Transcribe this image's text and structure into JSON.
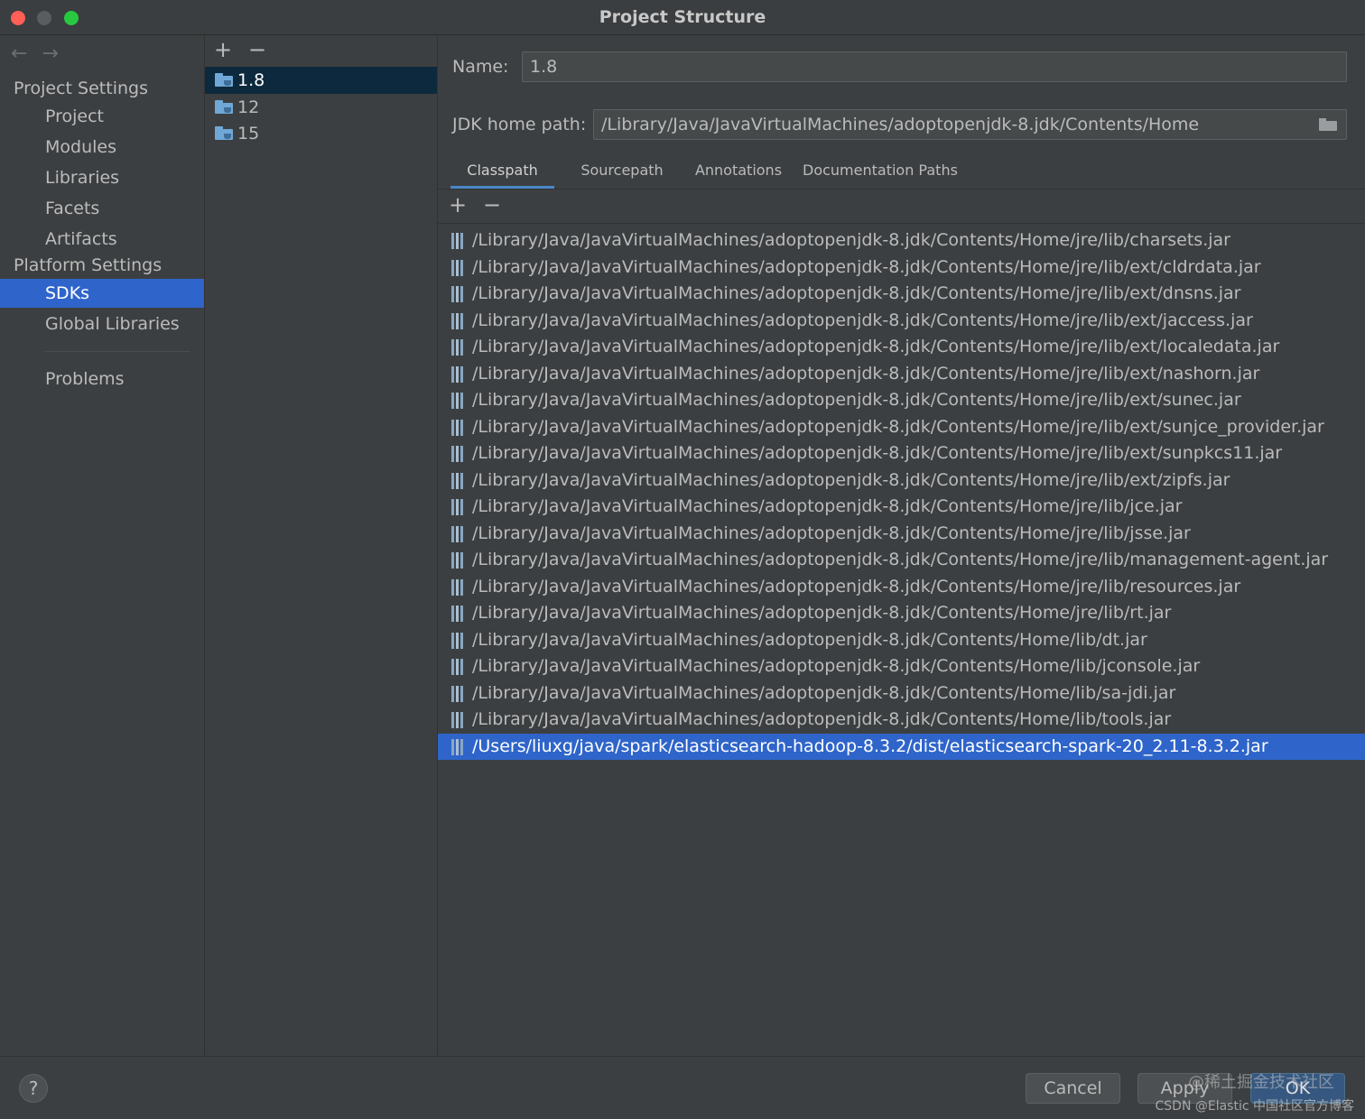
{
  "window": {
    "title": "Project Structure"
  },
  "sidebar": {
    "back_glyph": "←",
    "forward_glyph": "→",
    "project_settings_label": "Project Settings",
    "project_items": [
      "Project",
      "Modules",
      "Libraries",
      "Facets",
      "Artifacts"
    ],
    "platform_settings_label": "Platform Settings",
    "platform_items": [
      "SDKs",
      "Global Libraries"
    ],
    "selected_item": "SDKs",
    "problems_label": "Problems"
  },
  "sdk_list": {
    "add_glyph": "+",
    "remove_glyph": "−",
    "items": [
      "1.8",
      "12",
      "15"
    ],
    "selected": "1.8"
  },
  "detail": {
    "name_label": "Name:",
    "name_value": "1.8",
    "jdk_home_label": "JDK home path:",
    "jdk_home_value": "/Library/Java/JavaVirtualMachines/adoptopenjdk-8.jdk/Contents/Home",
    "tabs": [
      "Classpath",
      "Sourcepath",
      "Annotations",
      "Documentation Paths"
    ],
    "active_tab": "Classpath",
    "add_glyph": "+",
    "remove_glyph": "−",
    "classpath": [
      "/Library/Java/JavaVirtualMachines/adoptopenjdk-8.jdk/Contents/Home/jre/lib/charsets.jar",
      "/Library/Java/JavaVirtualMachines/adoptopenjdk-8.jdk/Contents/Home/jre/lib/ext/cldrdata.jar",
      "/Library/Java/JavaVirtualMachines/adoptopenjdk-8.jdk/Contents/Home/jre/lib/ext/dnsns.jar",
      "/Library/Java/JavaVirtualMachines/adoptopenjdk-8.jdk/Contents/Home/jre/lib/ext/jaccess.jar",
      "/Library/Java/JavaVirtualMachines/adoptopenjdk-8.jdk/Contents/Home/jre/lib/ext/localedata.jar",
      "/Library/Java/JavaVirtualMachines/adoptopenjdk-8.jdk/Contents/Home/jre/lib/ext/nashorn.jar",
      "/Library/Java/JavaVirtualMachines/adoptopenjdk-8.jdk/Contents/Home/jre/lib/ext/sunec.jar",
      "/Library/Java/JavaVirtualMachines/adoptopenjdk-8.jdk/Contents/Home/jre/lib/ext/sunjce_provider.jar",
      "/Library/Java/JavaVirtualMachines/adoptopenjdk-8.jdk/Contents/Home/jre/lib/ext/sunpkcs11.jar",
      "/Library/Java/JavaVirtualMachines/adoptopenjdk-8.jdk/Contents/Home/jre/lib/ext/zipfs.jar",
      "/Library/Java/JavaVirtualMachines/adoptopenjdk-8.jdk/Contents/Home/jre/lib/jce.jar",
      "/Library/Java/JavaVirtualMachines/adoptopenjdk-8.jdk/Contents/Home/jre/lib/jsse.jar",
      "/Library/Java/JavaVirtualMachines/adoptopenjdk-8.jdk/Contents/Home/jre/lib/management-agent.jar",
      "/Library/Java/JavaVirtualMachines/adoptopenjdk-8.jdk/Contents/Home/jre/lib/resources.jar",
      "/Library/Java/JavaVirtualMachines/adoptopenjdk-8.jdk/Contents/Home/jre/lib/rt.jar",
      "/Library/Java/JavaVirtualMachines/adoptopenjdk-8.jdk/Contents/Home/lib/dt.jar",
      "/Library/Java/JavaVirtualMachines/adoptopenjdk-8.jdk/Contents/Home/lib/jconsole.jar",
      "/Library/Java/JavaVirtualMachines/adoptopenjdk-8.jdk/Contents/Home/lib/sa-jdi.jar",
      "/Library/Java/JavaVirtualMachines/adoptopenjdk-8.jdk/Contents/Home/lib/tools.jar",
      "/Users/liuxg/java/spark/elasticsearch-hadoop-8.3.2/dist/elasticsearch-spark-20_2.11-8.3.2.jar"
    ],
    "selected_classpath_index": 19
  },
  "footer": {
    "help_label": "?",
    "cancel_label": "Cancel",
    "apply_label": "Apply",
    "ok_label": "OK",
    "watermark_top": "@稀土掘金技术社区",
    "watermark_bottom": "CSDN @Elastic 中国社区官方博客"
  },
  "icons": {
    "close": "traffic-close-icon",
    "minimize": "traffic-minimize-icon",
    "maximize": "traffic-maximize-icon",
    "sdk": "jdk-folder-icon",
    "jar": "jar-icon",
    "browse": "folder-browse-icon"
  },
  "colors": {
    "selection_blue": "#2f65ca",
    "sdk_selection": "#0d293e",
    "tab_underline": "#4a88c7",
    "ok_button": "#365880"
  }
}
